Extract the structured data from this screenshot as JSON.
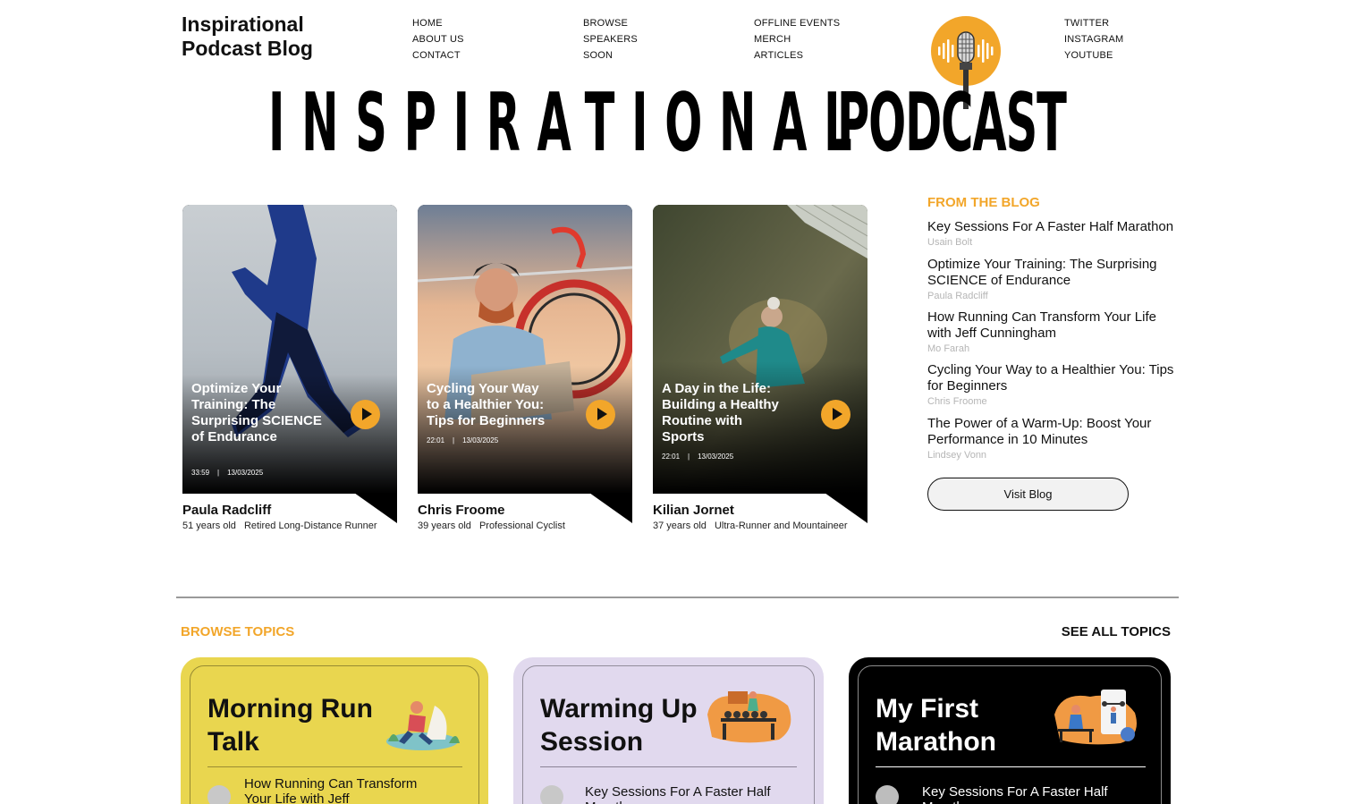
{
  "brand": {
    "line1": "Inspirational",
    "line2": "Podcast Blog"
  },
  "nav": {
    "col1": [
      "HOME",
      "ABOUT US",
      "CONTACT"
    ],
    "col2": [
      "BROWSE",
      "SPEAKERS",
      "SOON"
    ],
    "col3": [
      "OFFLINE EVENTS",
      "MERCH",
      "ARTICLES"
    ],
    "social": [
      "TWITTER",
      "INSTAGRAM",
      "YOUTUBE"
    ]
  },
  "hero": {
    "word1": "INSPIRATIONAL",
    "word2": "PODCAST"
  },
  "colors": {
    "accent": "#f2a62a",
    "black": "#000000",
    "yellow": "#e9d64f",
    "lavender": "#e1d9ee"
  },
  "cards": [
    {
      "title": "Optimize Your Training: The Surprising SCIENCE of Endurance",
      "duration": "33:59",
      "date": "13/03/2025",
      "name": "Paula Radcliff",
      "age": "51 years old",
      "role": "Retired Long-Distance Runner"
    },
    {
      "title": "Cycling Your Way to a Healthier You: Tips for Beginners",
      "duration": "22:01",
      "date": "13/03/2025",
      "name": "Chris Froome",
      "age": "39 years old",
      "role": "Professional Cyclist"
    },
    {
      "title": "A Day in the Life: Building a Healthy Routine with Sports",
      "duration": "22:01",
      "date": "13/03/2025",
      "name": "Kilian Jornet",
      "age": "37 years old",
      "role": "Ultra-Runner and Mountaineer"
    }
  ],
  "blog": {
    "heading": "FROM THE BLOG",
    "items": [
      {
        "title": "Key Sessions For A Faster Half Marathon",
        "author": "Usain Bolt"
      },
      {
        "title": "Optimize Your Training: The Surprising SCIENCE of Endurance",
        "author": "Paula Radcliff"
      },
      {
        "title": "How Running Can Transform Your Life with Jeff Cunningham",
        "author": "Mo Farah"
      },
      {
        "title": "Cycling Your Way to a Healthier You: Tips for Beginners",
        "author": "Chris Froome"
      },
      {
        "title": "The Power of a Warm-Up: Boost Your Performance in 10 Minutes",
        "author": "Lindsey Vonn"
      }
    ],
    "button": "Visit Blog"
  },
  "topics": {
    "heading": "BROWSE TOPICS",
    "see_all": "SEE ALL TOPICS",
    "items": [
      {
        "title_line1": "Morning Run",
        "title_line2": "Talk",
        "episode": "How Running Can Transform Your Life with Jeff"
      },
      {
        "title_line1": "Warming Up",
        "title_line2": "Session",
        "episode": "Key Sessions For A Faster Half Marathon"
      },
      {
        "title_line1": "My First",
        "title_line2": "Marathon",
        "episode": "Key Sessions For A Faster Half Marathon"
      }
    ]
  }
}
